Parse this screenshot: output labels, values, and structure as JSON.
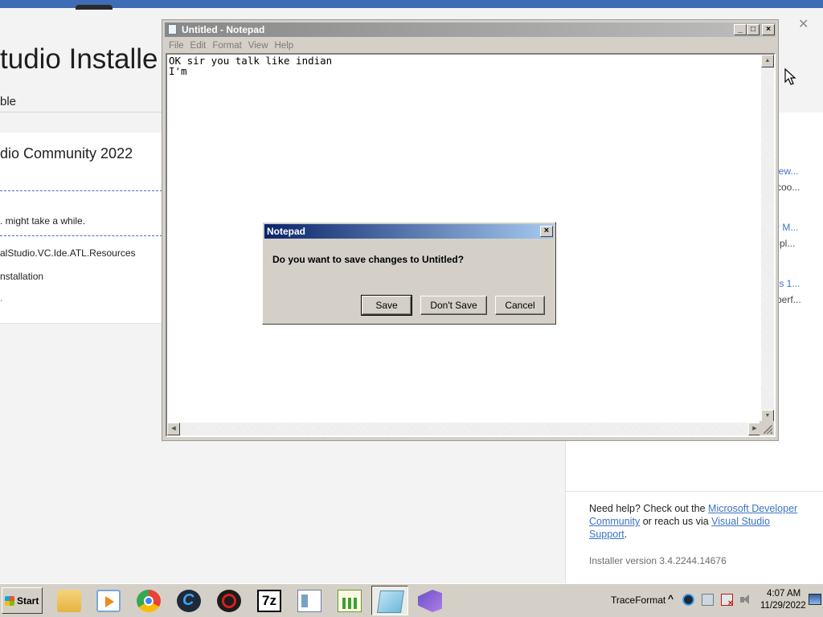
{
  "vs_installer": {
    "title": "tudio Installe",
    "tab": "ble",
    "product": "dio Community 2022",
    "progress_message": ". might take a while.",
    "package": "alStudio.VC.Ide.ATL.Resources",
    "installation": "nstallation",
    "dot": ".",
    "news": [
      {
        "link": "iew...",
        "desc": "coo..."
      },
      {
        "link": "r M...",
        "desc": "-pl..."
      },
      {
        "link": "ts 1...",
        "desc": "perf..."
      }
    ],
    "help": {
      "prefix": "Need help? Check out the ",
      "link1": "Microsoft Developer Community",
      "middle": " or reach us via ",
      "link2": "Visual Studio Support",
      "suffix": "."
    },
    "version": "Installer version 3.4.2244.14676",
    "close_glyph": "✕"
  },
  "notepad": {
    "title": "Untitled - Notepad",
    "menu": [
      "File",
      "Edit",
      "Format",
      "View",
      "Help"
    ],
    "content": "OK sir you talk like indian\nI'm"
  },
  "dialog": {
    "title": "Notepad",
    "message": "Do you want to save changes to Untitled?",
    "buttons": {
      "save": "Save",
      "dont_save": "Don't Save",
      "cancel": "Cancel"
    }
  },
  "taskbar": {
    "start_label": "Start",
    "items": [
      "folder-icon",
      "media-player-icon",
      "chrome-icon",
      "ccleaner-icon",
      "red-app-icon",
      "7zip-icon",
      "document-icon",
      "chart-app-icon",
      "notepad-icon",
      "visual-studio-installer-icon"
    ],
    "active_item": "notepad-icon",
    "tray_label": "TraceFormat",
    "tray_expand": "^",
    "time": "4:07 AM",
    "date": "11/29/2022"
  },
  "colors": {
    "vs_accent": "#3e6db5",
    "link": "#3c74c4",
    "dialog_title_start": "#0a246a",
    "dialog_title_end": "#a6caf0",
    "classic_face": "#d4d0c8"
  }
}
